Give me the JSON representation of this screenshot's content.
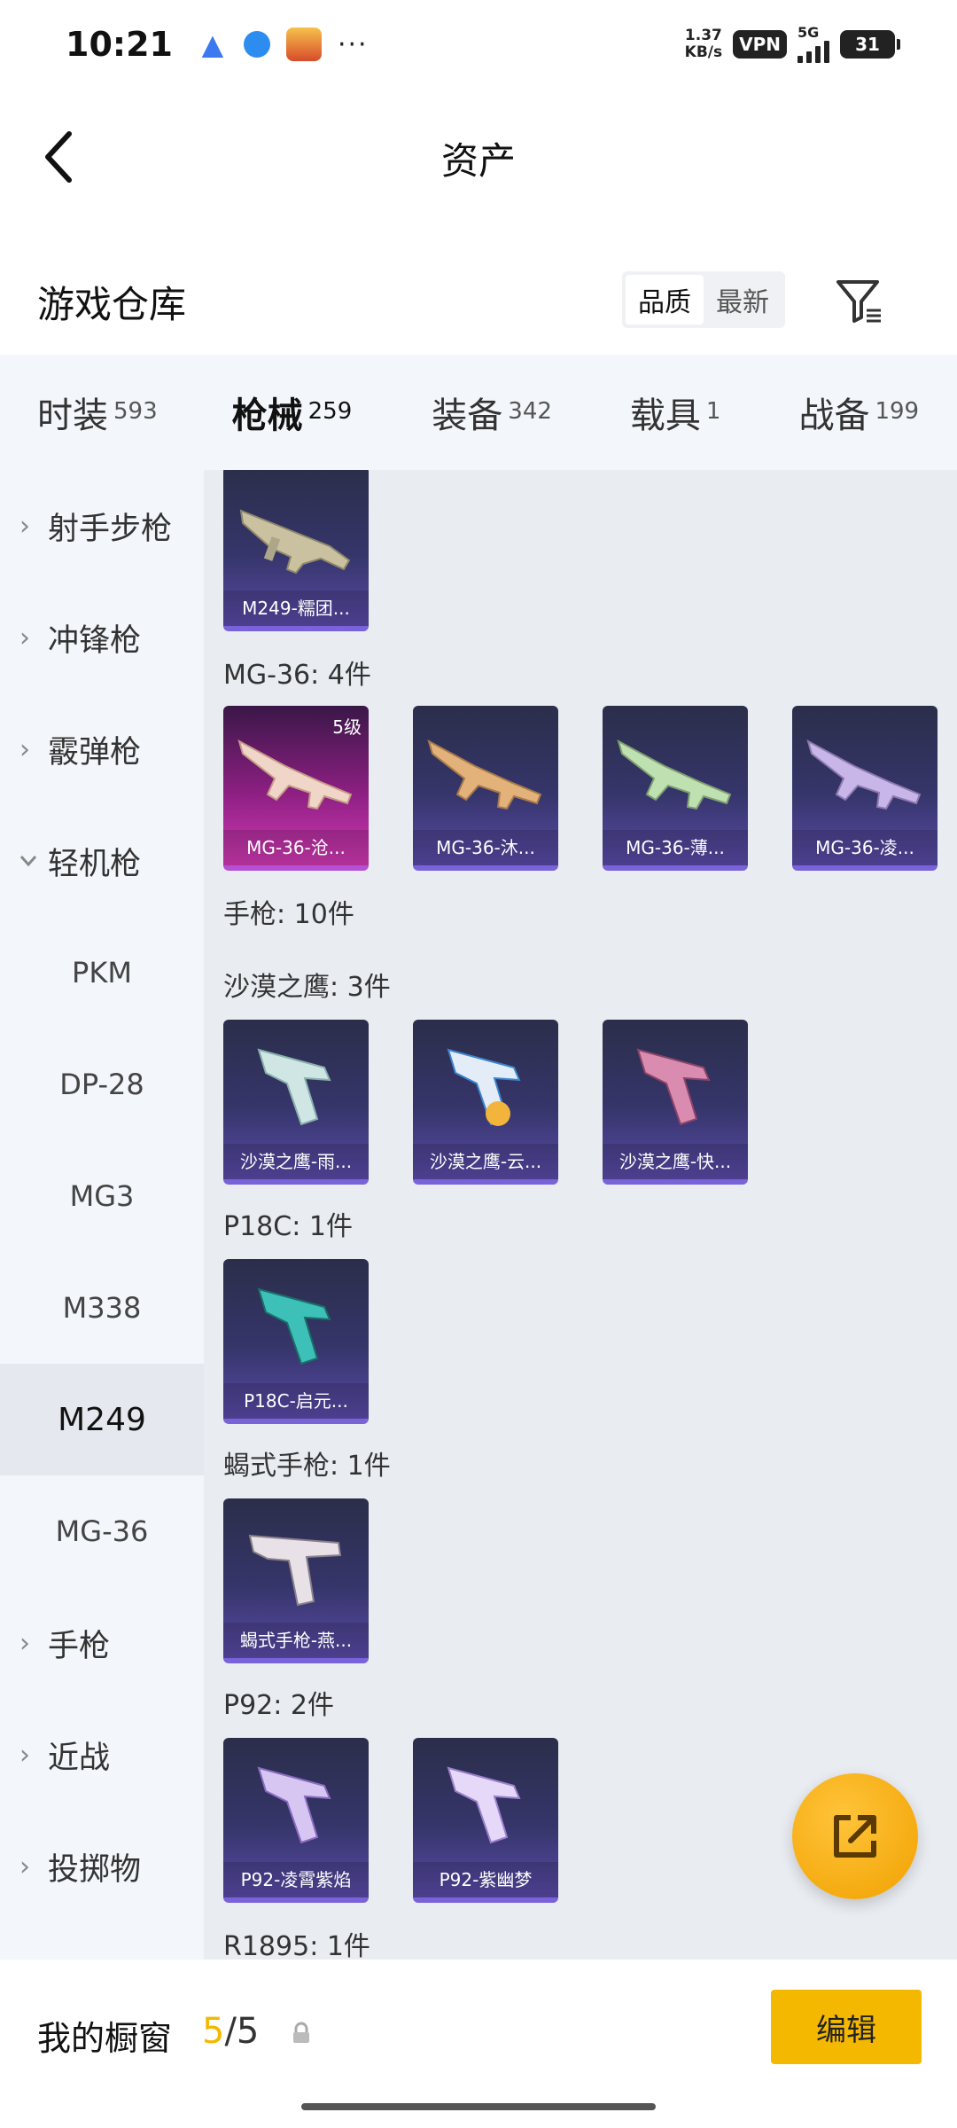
{
  "status_bar": {
    "time": "10:21",
    "speed_value": "1.37",
    "speed_unit": "KB/s",
    "vpn": "VPN",
    "network": "5G",
    "battery": "31",
    "more": "···"
  },
  "header": {
    "title": "资产"
  },
  "warehouse": {
    "title": "游戏仓库",
    "sort_options": [
      "品质",
      "最新"
    ],
    "active_sort": "品质"
  },
  "categories": [
    {
      "label": "时装",
      "count": "593"
    },
    {
      "label": "枪械",
      "count": "259",
      "active": true
    },
    {
      "label": "装备",
      "count": "342"
    },
    {
      "label": "载具",
      "count": "1"
    },
    {
      "label": "战备",
      "count": "199"
    }
  ],
  "sidebar": [
    {
      "label": "射手步枪",
      "type": "collapsed"
    },
    {
      "label": "冲锋枪",
      "type": "collapsed"
    },
    {
      "label": "霰弹枪",
      "type": "collapsed"
    },
    {
      "label": "轻机枪",
      "type": "expanded"
    },
    {
      "label": "PKM",
      "type": "sub"
    },
    {
      "label": "DP-28",
      "type": "sub"
    },
    {
      "label": "MG3",
      "type": "sub"
    },
    {
      "label": "M338",
      "type": "sub"
    },
    {
      "label": "M249",
      "type": "sub",
      "selected": true
    },
    {
      "label": "MG-36",
      "type": "sub"
    },
    {
      "label": "手枪",
      "type": "collapsed"
    },
    {
      "label": "近战",
      "type": "collapsed"
    },
    {
      "label": "投掷物",
      "type": "collapsed"
    }
  ],
  "content": {
    "groups": [
      {
        "title": "",
        "items": [
          {
            "name": "M249-糯团...",
            "level": "",
            "style": "purple",
            "weapon": "lmg"
          }
        ]
      },
      {
        "title": "MG-36: 4件",
        "items": [
          {
            "name": "MG-36-沧...",
            "level": "5级",
            "style": "pink",
            "weapon": "rifle"
          },
          {
            "name": "MG-36-沐...",
            "level": "",
            "style": "purple",
            "weapon": "rifle"
          },
          {
            "name": "MG-36-薄...",
            "level": "",
            "style": "purple",
            "weapon": "rifle"
          },
          {
            "name": "MG-36-凌...",
            "level": "",
            "style": "purple",
            "weapon": "rifle"
          }
        ]
      },
      {
        "title": "手枪: 10件",
        "items": []
      },
      {
        "title": "沙漠之鹰: 3件",
        "items": [
          {
            "name": "沙漠之鹰-雨...",
            "level": "",
            "style": "purple",
            "weapon": "pistol"
          },
          {
            "name": "沙漠之鹰-云...",
            "level": "",
            "style": "purple",
            "weapon": "pistol"
          },
          {
            "name": "沙漠之鹰-快...",
            "level": "",
            "style": "purple",
            "weapon": "pistol"
          }
        ]
      },
      {
        "title": "P18C: 1件",
        "items": [
          {
            "name": "P18C-启元...",
            "level": "",
            "style": "purple",
            "weapon": "pistol"
          }
        ]
      },
      {
        "title": "蝎式手枪: 1件",
        "items": [
          {
            "name": "蝎式手枪-燕...",
            "level": "",
            "style": "purple",
            "weapon": "smg"
          }
        ]
      },
      {
        "title": "P92: 2件",
        "items": [
          {
            "name": "P92-凌霄紫焰",
            "level": "",
            "style": "purple",
            "weapon": "pistol"
          },
          {
            "name": "P92-紫幽梦",
            "level": "",
            "style": "purple",
            "weapon": "pistol"
          }
        ]
      },
      {
        "title": "R1895: 1件",
        "items": []
      }
    ]
  },
  "bottom_bar": {
    "label": "我的橱窗",
    "current": "5",
    "separator_total": "/5",
    "edit_label": "编辑"
  },
  "colors": {
    "accent": "#f5b800",
    "card_purple": "#35356a",
    "card_pink": "#d23ab4"
  }
}
